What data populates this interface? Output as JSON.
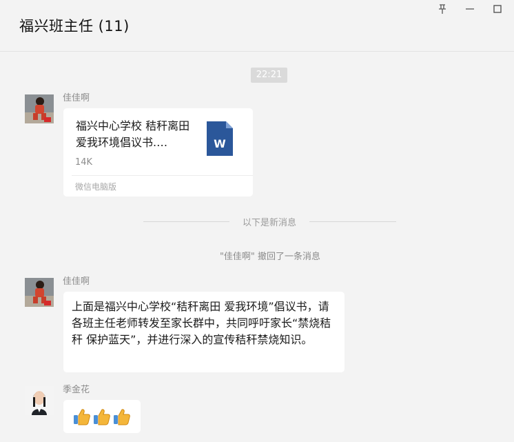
{
  "window": {
    "title": "福兴班主任 (11)",
    "controls": [
      "pin-icon",
      "minimize-icon",
      "maximize-icon"
    ]
  },
  "messages": {
    "timestamp": "22:21",
    "file_message": {
      "sender": "佳佳啊",
      "file_name": "福兴中心学校 秸秆离田 爱我环境倡议书.…",
      "file_size": "14K",
      "file_icon_letter": "W",
      "source": "微信电脑版"
    },
    "new_divider": "以下是新消息",
    "recall_notice": "\"佳佳啊\" 撤回了一条消息",
    "text_message": {
      "sender": "佳佳啊",
      "text": "上面是福兴中心学校“秸秆离田 爱我环境”倡议书，请各班主任老师转发至家长群中，共同呼吁家长“禁烧秸秆 保护蓝天”，并进行深入的宣传秸秆禁烧知识。"
    },
    "emoji_message": {
      "sender": "季金花",
      "emojis": [
        "thumbs-up",
        "thumbs-up",
        "thumbs-up"
      ]
    }
  },
  "colors": {
    "background": "#f3f3f3",
    "bubble": "#ffffff",
    "word_icon": "#2b579a",
    "thumb": "#f4b63a"
  }
}
